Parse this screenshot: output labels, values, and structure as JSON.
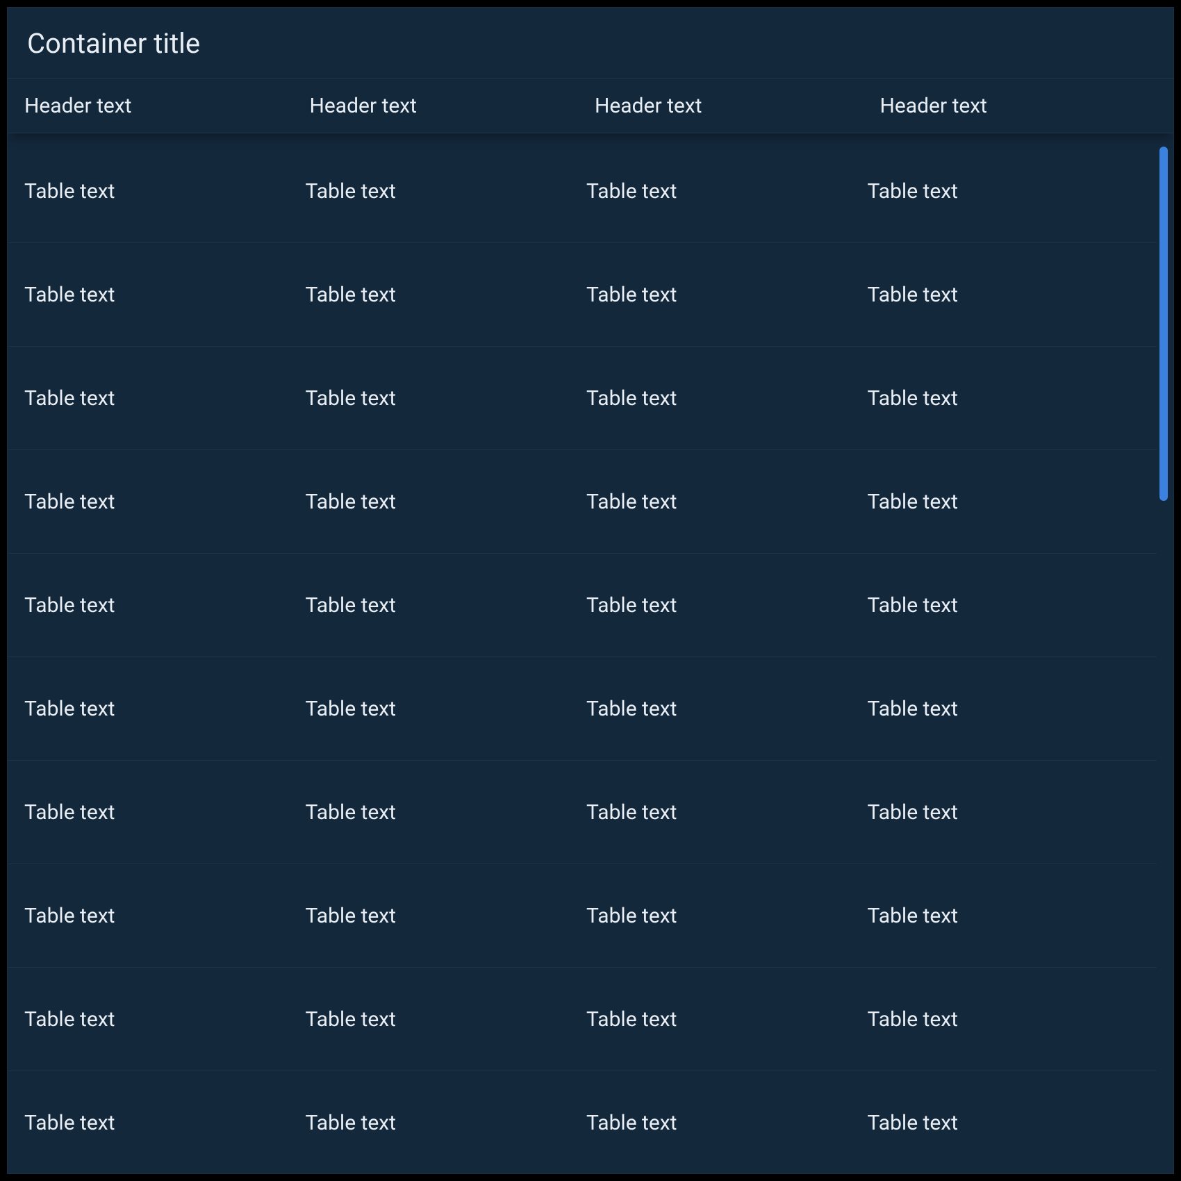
{
  "container": {
    "title": "Container title"
  },
  "table": {
    "headers": [
      "Header text",
      "Header text",
      "Header text",
      "Header text"
    ],
    "rows": [
      [
        "Table text",
        "Table text",
        "Table text",
        "Table text"
      ],
      [
        "Table text",
        "Table text",
        "Table text",
        "Table text"
      ],
      [
        "Table text",
        "Table text",
        "Table text",
        "Table text"
      ],
      [
        "Table text",
        "Table text",
        "Table text",
        "Table text"
      ],
      [
        "Table text",
        "Table text",
        "Table text",
        "Table text"
      ],
      [
        "Table text",
        "Table text",
        "Table text",
        "Table text"
      ],
      [
        "Table text",
        "Table text",
        "Table text",
        "Table text"
      ],
      [
        "Table text",
        "Table text",
        "Table text",
        "Table text"
      ],
      [
        "Table text",
        "Table text",
        "Table text",
        "Table text"
      ],
      [
        "Table text",
        "Table text",
        "Table text",
        "Table text"
      ]
    ]
  },
  "colors": {
    "background": "#14283c",
    "text": "#e8eef4",
    "scrollbar": "#3b82e0"
  }
}
